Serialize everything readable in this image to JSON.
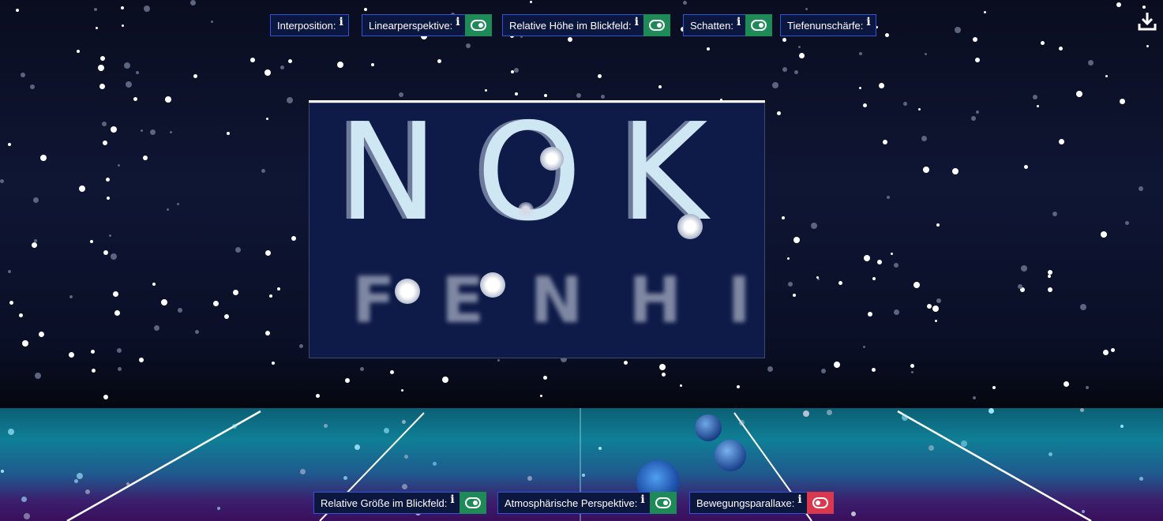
{
  "top_controls": [
    {
      "label": "Interposition:",
      "info": "i",
      "toggle": "none"
    },
    {
      "label": "Linearperspektive:",
      "info": "i",
      "toggle": "on"
    },
    {
      "label": "Relative Höhe im Blickfeld:",
      "info": "i",
      "toggle": "on"
    },
    {
      "label": "Schatten:",
      "info": "i",
      "toggle": "on"
    },
    {
      "label": "Tiefenunschärfe:",
      "info": "i",
      "toggle": "none"
    }
  ],
  "bottom_controls": [
    {
      "label": "Relative Größe im Blickfeld:",
      "info": "i",
      "toggle": "on"
    },
    {
      "label": "Atmosphärische Perspektive:",
      "info": "i",
      "toggle": "on"
    },
    {
      "label": "Bewegungsparallaxe:",
      "info": "i",
      "toggle": "off"
    }
  ],
  "scene": {
    "sharp_letters": [
      "N",
      "O",
      "K"
    ],
    "blurred_letters": [
      "F",
      "E",
      "N",
      "H",
      "I"
    ]
  },
  "icons": {
    "download": "download-icon"
  },
  "colors": {
    "toggle_on": "#1d8a57",
    "toggle_off": "#d9384f",
    "control_border": "#2f54d8"
  }
}
